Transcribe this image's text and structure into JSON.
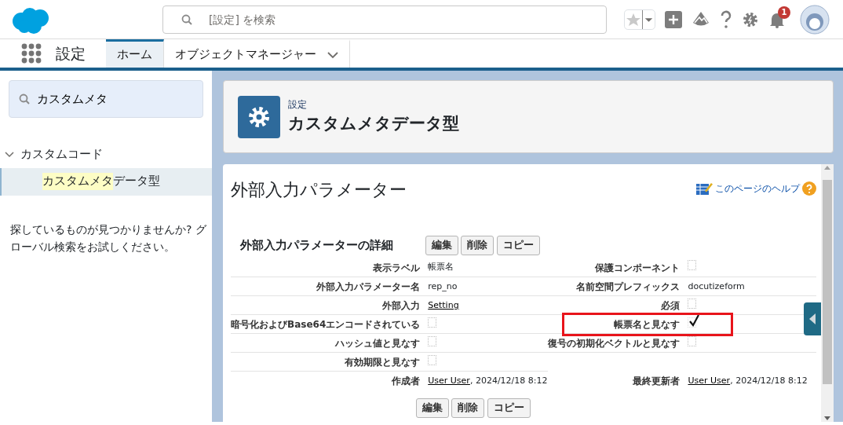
{
  "header": {
    "search_placeholder": "[設定] を検索",
    "notification_count": "1"
  },
  "nav": {
    "app_name": "設定",
    "tabs": [
      {
        "label": "ホーム",
        "selected": true,
        "has_menu": false
      },
      {
        "label": "オブジェクトマネージャー",
        "selected": false,
        "has_menu": true
      }
    ]
  },
  "sidebar": {
    "search_value": "カスタムメタ",
    "groups": [
      {
        "label": "カスタムコード",
        "expanded": true,
        "children": [
          {
            "label_match": "カスタムメタ",
            "label_rest": "データ型",
            "selected": true
          }
        ]
      }
    ],
    "hint": "探しているものが見つかりませんか? グローバル検索をお試しください。"
  },
  "page_header": {
    "breadcrumb": "設定",
    "title": "カスタムメタデータ型"
  },
  "detail": {
    "title": "外部入力パラメーター",
    "help_link": "このページのヘルプ",
    "section_title": "外部入力パラメーターの詳細",
    "buttons": [
      "編集",
      "削除",
      "コピー"
    ],
    "rows": [
      {
        "left": {
          "label": "表示ラベル",
          "kind": "text",
          "value": "帳票名"
        },
        "right": {
          "label": "保護コンポーネント",
          "kind": "checkbox",
          "checked": false
        }
      },
      {
        "left": {
          "label": "外部入力パラメーター名",
          "kind": "text",
          "value": "rep_no"
        },
        "right": {
          "label": "名前空間プレフィックス",
          "kind": "text",
          "value": "docutizeform"
        }
      },
      {
        "left": {
          "label": "外部入力",
          "kind": "link",
          "value": "Setting"
        },
        "right": {
          "label": "必須",
          "kind": "checkbox",
          "checked": false
        }
      },
      {
        "left": {
          "label": "暗号化およびBase64エンコードされている",
          "kind": "checkbox",
          "checked": false
        },
        "right": {
          "label": "帳票名と見なす",
          "kind": "checkbox",
          "checked": true,
          "highlighted": true
        }
      },
      {
        "left": {
          "label": "ハッシュ値と見なす",
          "kind": "checkbox",
          "checked": false
        },
        "right": {
          "label": "復号の初期化ベクトルと見なす",
          "kind": "checkbox",
          "checked": false
        }
      },
      {
        "left": {
          "label": "有効期限と見なす",
          "kind": "checkbox",
          "checked": false
        }
      },
      {
        "left": {
          "label": "作成者",
          "kind": "user",
          "user": "User User",
          "value": ", 2024/12/18 8:12"
        },
        "right": {
          "label": "最終更新者",
          "kind": "user",
          "user": "User User",
          "value": ", 2024/12/18 8:12"
        }
      }
    ],
    "bottom_buttons": [
      "編集",
      "削除",
      "コピー"
    ]
  }
}
